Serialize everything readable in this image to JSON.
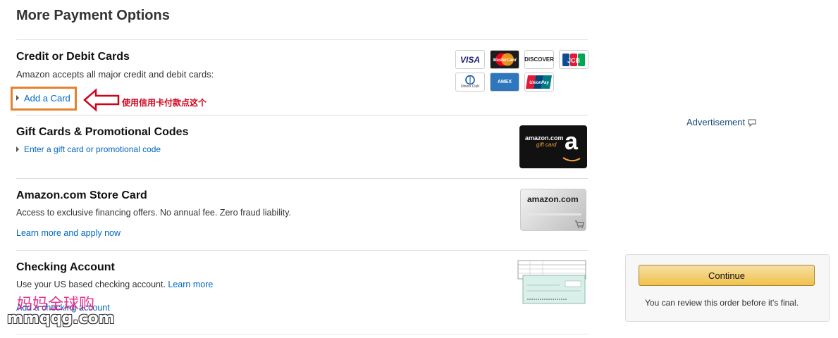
{
  "page": {
    "title": "More Payment Options"
  },
  "credit": {
    "title": "Credit or Debit Cards",
    "desc": "Amazon accepts all major credit and debit cards:",
    "add_link": "Add a Card",
    "logos": [
      "VISA",
      "MasterCard",
      "DISCOVER",
      "JCB",
      "Diners Club",
      "AMEX",
      "UnionPay"
    ]
  },
  "annotation": {
    "text": "使用信用卡付款点这个",
    "color": "#d0021b",
    "box_color": "#e8812b"
  },
  "gift": {
    "title": "Gift Cards & Promotional Codes",
    "link": "Enter a gift card or promotional code",
    "card_line1": "amazon.com",
    "card_line2": "gift card",
    "card_letter": "a"
  },
  "store": {
    "title": "Amazon.com Store Card",
    "desc": "Access to exclusive financing offers. No annual fee. Zero fraud liability.",
    "link": "Learn more and apply now",
    "card_brand": "amazon.com"
  },
  "checking": {
    "title": "Checking Account",
    "desc": "Use your US based checking account.",
    "learn_link": "Learn more",
    "add_link": "Add a checking account"
  },
  "sidebar": {
    "ad_label": "Advertisement",
    "continue_label": "Continue",
    "note": "You can review this order before it's final."
  },
  "watermark": {
    "line1": "妈妈全球购",
    "line2": "mmqqg.com"
  },
  "colors": {
    "link": "#0066c0",
    "button": "#f0c14b"
  }
}
